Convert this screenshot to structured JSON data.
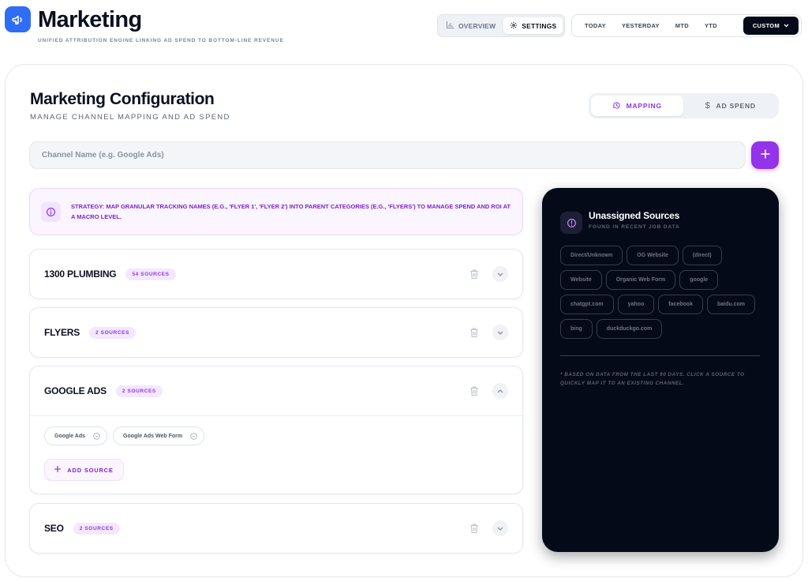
{
  "header": {
    "title": "Marketing",
    "subtitle": "UNIFIED ATTRIBUTION ENGINE LINKING AD SPEND TO BOTTOM-LINE REVENUE",
    "logo_icon": "megaphone-icon",
    "views": [
      {
        "label": "OVERVIEW",
        "icon": "bar-chart-icon",
        "active": false
      },
      {
        "label": "SETTINGS",
        "icon": "gear-icon",
        "active": true
      }
    ],
    "ranges": [
      "TODAY",
      "YESTERDAY",
      "MTD",
      "YTD"
    ],
    "custom_range": "CUSTOM"
  },
  "config": {
    "title": "Marketing Configuration",
    "subtitle": "MANAGE CHANNEL MAPPING AND AD SPEND",
    "modes": [
      {
        "label": "MAPPING",
        "icon": "mapping-icon",
        "active": true
      },
      {
        "label": "AD SPEND",
        "icon": "dollar-icon",
        "active": false
      }
    ],
    "channel_input": {
      "placeholder": "Channel Name (e.g. Google Ads)",
      "value": ""
    },
    "strategy": {
      "label": "STRATEGY:",
      "text": "MAP GRANULAR TRACKING NAMES (E.G., 'FLYER 1', 'FLYER 2') INTO PARENT CATEGORIES (E.G., 'FLYERS') TO MANAGE SPEND AND ROI AT A MACRO LEVEL."
    },
    "channels": [
      {
        "name": "1300 PLUMBING",
        "badge": "54 SOURCES",
        "expanded": false
      },
      {
        "name": "FLYERS",
        "badge": "2 SOURCES",
        "expanded": false
      },
      {
        "name": "GOOGLE ADS",
        "badge": "2 SOURCES",
        "expanded": true,
        "sources": [
          "Google Ads",
          "Google Ads Web Form"
        ]
      },
      {
        "name": "SEO",
        "badge": "2 SOURCES",
        "expanded": false
      }
    ],
    "add_source_label": "ADD SOURCE"
  },
  "unassigned": {
    "title": "Unassigned Sources",
    "subtitle": "FOUND IN RECENT JOB DATA",
    "sources": [
      "Direct/Unknown",
      "OG Website",
      "(direct)",
      "Website",
      "Organic Web Form",
      "google",
      "chatgpt.com",
      "yahoo",
      "facebook",
      "baidu.com",
      "bing",
      "duckduckgo.com"
    ],
    "note": "* BASED ON DATA FROM THE LAST 90 DAYS. CLICK A SOURCE TO QUICKLY MAP IT TO AN EXISTING CHANNEL."
  },
  "colors": {
    "accent": "#9333ea",
    "brand": "#2f6df6",
    "dark": "#050a18"
  }
}
